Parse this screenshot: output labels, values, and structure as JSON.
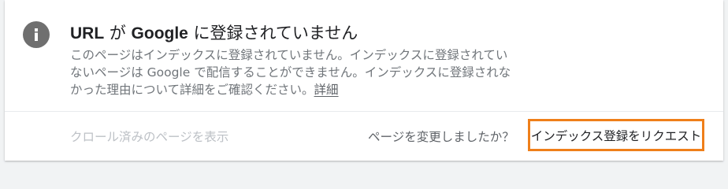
{
  "notice": {
    "icon": "info-icon",
    "title_en": "URL",
    "title_jp1": " が ",
    "title_en2": "Google",
    "title_jp2": " に登録されていません",
    "description_lines": [
      "このページはインデックスに登録されていません。インデックスに登録されてい",
      "ないページは Google で配信することができません。インデックスに登録されな",
      "かった理由について詳細をご確認ください。"
    ],
    "details_link": "詳細"
  },
  "footer": {
    "view_crawled_label": "クロール済みのページを表示",
    "changed_question": "ページを変更しましたか？",
    "request_indexing_label": "インデックス登録をリクエスト"
  },
  "colors": {
    "highlight_border": "#ef7f1a",
    "icon_bg": "#6f6f6f"
  }
}
